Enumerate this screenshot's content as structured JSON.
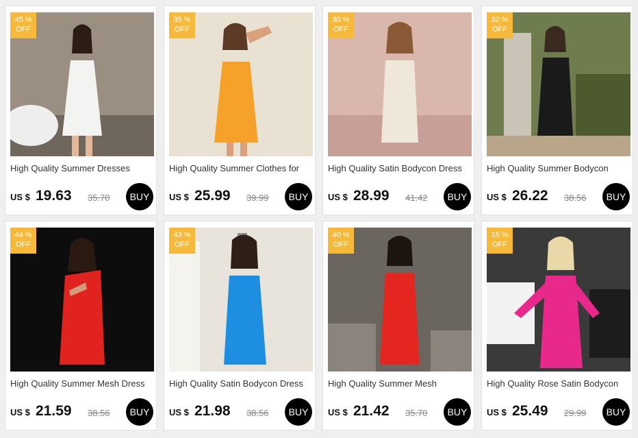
{
  "colors": {
    "badge": "#f6b93b",
    "buy_button": "#000000",
    "price": "#111111",
    "old_price": "#888888"
  },
  "products": [
    {
      "discount": "45 %",
      "discount_suffix": "OFF",
      "title": "High Quality Summer Dresses",
      "currency": "US $",
      "price": "19.63",
      "old_price": "35.70",
      "buy_label": "BUY",
      "image": "model-white-satin-dress",
      "dress_color": "#f3f3f1",
      "bg_color": "#9a8f80"
    },
    {
      "discount": "35 %",
      "discount_suffix": "OFF",
      "title": "High Quality Summer Clothes for",
      "currency": "US $",
      "price": "25.99",
      "old_price": "39.99",
      "buy_label": "BUY",
      "image": "model-orange-satin-dress",
      "dress_color": "#f5a12a",
      "bg_color": "#e9e1d2"
    },
    {
      "discount": "30 %",
      "discount_suffix": "OFF",
      "title": "High Quality Satin Bodycon Dress",
      "currency": "US $",
      "price": "28.99",
      "old_price": "41.42",
      "buy_label": "BUY",
      "image": "model-cream-corset-dress",
      "dress_color": "#efe8da",
      "bg_color": "#d9b7ad"
    },
    {
      "discount": "32 %",
      "discount_suffix": "OFF",
      "title": "High Quality Summer Bodycon",
      "currency": "US $",
      "price": "26.22",
      "old_price": "38.56",
      "buy_label": "BUY",
      "image": "model-black-dress-garden",
      "dress_color": "#1a1a1a",
      "bg_color": "#6f7d4e"
    },
    {
      "discount": "44 %",
      "discount_suffix": "OFF",
      "title": "High Quality Summer Mesh Dress",
      "currency": "US $",
      "price": "21.59",
      "old_price": "38.56",
      "buy_label": "BUY",
      "image": "model-red-cutout-dress",
      "dress_color": "#e0231e",
      "bg_color": "#0d0d0d"
    },
    {
      "discount": "43 %",
      "discount_suffix": "OFF",
      "title": "High Quality Satin Bodycon Dress",
      "currency": "US $",
      "price": "21.98",
      "old_price": "38.56",
      "buy_label": "BUY",
      "image": "model-blue-satin-dress",
      "dress_color": "#1e8fe0",
      "bg_color": "#e8e4dc"
    },
    {
      "discount": "40 %",
      "discount_suffix": "OFF",
      "title": "High Quality Summer Mesh",
      "currency": "US $",
      "price": "21.42",
      "old_price": "35.70",
      "buy_label": "BUY",
      "image": "model-red-mesh-dress",
      "dress_color": "#e3261f",
      "bg_color": "#6b6560"
    },
    {
      "discount": "15 %",
      "discount_suffix": "OFF",
      "title": "High Quality Rose Satin Bodycon",
      "currency": "US $",
      "price": "25.49",
      "old_price": "29.99",
      "buy_label": "BUY",
      "image": "model-pink-satin-dress",
      "dress_color": "#e8288a",
      "bg_color": "#3a3a3a"
    }
  ]
}
